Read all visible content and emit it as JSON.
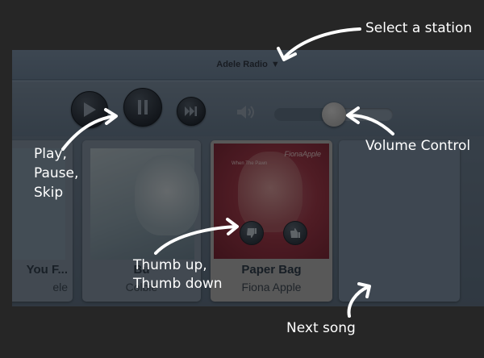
{
  "header": {
    "station_label": "Adele Radio",
    "caret": "▼"
  },
  "controls": {
    "play_icon": "play-icon",
    "pause_icon": "pause-icon",
    "skip_icon": "skip-icon",
    "volume_icon": "speaker-icon",
    "volume_level": 0.5
  },
  "songs": [
    {
      "title": "You F...",
      "artist": "ele"
    },
    {
      "title": "Bu",
      "artist": "Colbie"
    },
    {
      "title": "Paper Bag",
      "artist": "Fiona Apple",
      "art_caption": "FionaApple",
      "art_subtitle": "When The Pawn"
    },
    {
      "title": "",
      "artist": ""
    }
  ],
  "annotations": {
    "select_station": "Select a station",
    "play_pause_skip": [
      "Play,",
      "Pause,",
      "Skip"
    ],
    "volume_control": "Volume Control",
    "thumbs": [
      "Thumb up,",
      "Thumb down"
    ],
    "next_song": "Next song"
  },
  "colors": {
    "background": "#262626",
    "app_blue": "#6f879f",
    "annotation_text": "#ffffff"
  }
}
